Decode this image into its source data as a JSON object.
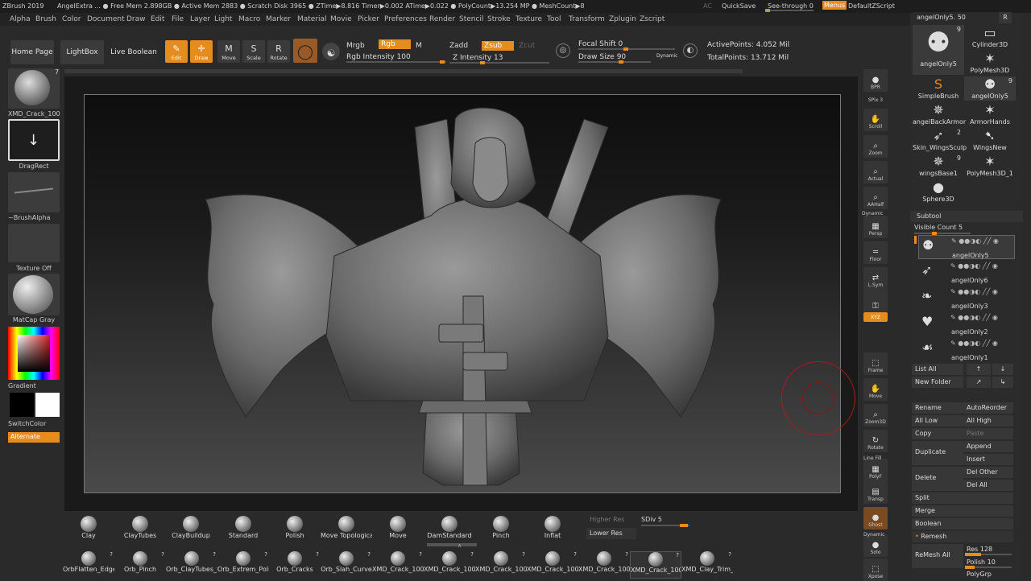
{
  "titlebar": {
    "app": "ZBrush 2019",
    "doc": "AngelExtra",
    "stats": "… ● Free Mem 2.898GB ● Active Mem 2883 ● Scratch Disk 3965 ● ZTime▶8.816 Timer▶0.002 ATime▶0.022 ● PolyCount▶13.254 MP ● MeshCount▶8",
    "ac": "AC",
    "quicksave": "QuickSave",
    "seethrough": "See-through  0",
    "seethrough_value": 0,
    "menus": "Menus",
    "script": "DefaultZScript"
  },
  "menus": [
    "Alpha",
    "Brush",
    "Color",
    "Document",
    "Draw",
    "Edit",
    "File",
    "Layer",
    "Light",
    "Macro",
    "Marker",
    "Material",
    "Movie",
    "Picker",
    "Preferences",
    "Render",
    "Stencil",
    "Stroke",
    "Texture",
    "Tool",
    "Transform",
    "Zplugin",
    "Zscript"
  ],
  "toolbar": {
    "home": "Home Page",
    "lightbox": "LightBox",
    "liveboolean": "Live Boolean",
    "tools": [
      {
        "name": "edit",
        "label": "Edit",
        "icon": "✎",
        "on": true
      },
      {
        "name": "draw",
        "label": "Draw",
        "icon": "✛",
        "on": true
      },
      {
        "name": "move",
        "label": "Move",
        "icon": "M",
        "on": false
      },
      {
        "name": "scale",
        "label": "Scale",
        "icon": "S",
        "on": false
      },
      {
        "name": "rotate",
        "label": "Rotate",
        "icon": "R",
        "on": false
      }
    ],
    "mrgb": "Mrgb",
    "rgb": "Rgb",
    "m": "M",
    "rgb_intensity": "Rgb Intensity 100",
    "zadd": "Zadd",
    "zsub": "Zsub",
    "zcut": "Zcut",
    "z_intensity": "Z Intensity 13",
    "focal_shift": "Focal Shift 0",
    "draw_size": "Draw Size 90",
    "dynamic": "Dynamic",
    "active_points": "ActivePoints: 4.052 Mil",
    "total_points": "TotalPoints: 13.712 Mil"
  },
  "left": {
    "alpha": "XMD_Crack_100",
    "alpha_count": "7",
    "stroke": "DragRect",
    "brushalpha": "~BrushAlpha",
    "texture": "Texture Off",
    "material": "MatCap Gray",
    "gradient": "Gradient",
    "switchcolor": "SwitchColor",
    "alternate": "Alternate"
  },
  "shelf": [
    {
      "name": "bpr",
      "label": "BPR",
      "icon": "●"
    },
    {
      "name": "spix",
      "label": "SPix 3",
      "icon": ""
    },
    {
      "name": "scroll",
      "label": "Scroll",
      "icon": "✋"
    },
    {
      "name": "zoom",
      "label": "Zoom",
      "icon": "⌕"
    },
    {
      "name": "actual",
      "label": "Actual",
      "icon": "⌕"
    },
    {
      "name": "aahalf",
      "label": "AAHalf",
      "icon": "⌕"
    },
    {
      "name": "persp",
      "label": "Persp",
      "icon": "▦"
    },
    {
      "name": "floor",
      "label": "Floor",
      "icon": "═"
    },
    {
      "name": "lsym",
      "label": "L.Sym",
      "icon": "⇄"
    },
    {
      "name": "lock",
      "label": "",
      "icon": "⚿"
    },
    {
      "name": "xyz",
      "label": "XYZ",
      "icon": ""
    },
    {
      "name": "frame",
      "label": "Frame",
      "icon": "⬚"
    },
    {
      "name": "move",
      "label": "Move",
      "icon": "✋"
    },
    {
      "name": "zoom3d",
      "label": "Zoom3D",
      "icon": "⌕"
    },
    {
      "name": "rotate",
      "label": "Rotate",
      "icon": "↻"
    },
    {
      "name": "polyf",
      "label": "PolyF",
      "icon": "▦"
    },
    {
      "name": "transp",
      "label": "Transp",
      "icon": "▤"
    },
    {
      "name": "ghost",
      "label": "Ghost",
      "icon": "●"
    },
    {
      "name": "solo",
      "label": "Solo",
      "icon": "●"
    },
    {
      "name": "xpose",
      "label": "Xpose",
      "icon": "⬚"
    }
  ],
  "shelf_extra": {
    "dynamic": "Dynamic",
    "linefill": "Line Fill",
    "dynamic2": "Dynamic"
  },
  "toolpalette": {
    "current": "angelOnly5. 50",
    "r": "R",
    "items": [
      {
        "label": "angelOnly5",
        "count": "9",
        "icon": "⚉"
      },
      {
        "label": "Cylinder3D",
        "count": "",
        "icon": "▭"
      },
      {
        "label": "PolyMesh3D",
        "count": "",
        "icon": "✶"
      },
      {
        "label": "SimpleBrush",
        "count": "",
        "icon": "S"
      },
      {
        "label": "angelOnly5",
        "count": "9",
        "icon": "⚉"
      },
      {
        "label": "angelBackArmor",
        "count": "",
        "icon": "✵"
      },
      {
        "label": "ArmorHands",
        "count": "",
        "icon": "✶"
      },
      {
        "label": "Skin_WingsSculp",
        "count": "2",
        "icon": "➶"
      },
      {
        "label": "WingsNew",
        "count": "",
        "icon": "➷"
      },
      {
        "label": "wingsBase1",
        "count": "9",
        "icon": "✵"
      },
      {
        "label": "PolyMesh3D_1",
        "count": "",
        "icon": "✶"
      },
      {
        "label": "Sphere3D",
        "count": "",
        "icon": "●"
      }
    ],
    "subtool": "Subtool",
    "visible_count": "Visible Count 5",
    "subtools": [
      "angelOnly5",
      "angelOnly6",
      "angelOnly3",
      "angelOnly2",
      "angelOnly1"
    ],
    "listall": "List All",
    "newfolder": "New Folder",
    "rename": "Rename",
    "autoreorder": "AutoReorder",
    "alllow": "All Low",
    "allhigh": "All High",
    "copy": "Copy",
    "paste": "Paste",
    "duplicate": "Duplicate",
    "append": "Append",
    "insert": "Insert",
    "delete": "Delete",
    "delother": "Del Other",
    "delall": "Del All",
    "split": "Split",
    "merge": "Merge",
    "boolean": "Boolean",
    "remesh": "Remesh",
    "remeshall": "ReMesh All",
    "res": "Res 128",
    "polish": "Polish 10",
    "polygrp": "PolyGrp"
  },
  "bottom": {
    "brushes1": [
      "Clay",
      "ClayTubes",
      "ClayBuildup",
      "Standard",
      "Polish",
      "Move Topologica",
      "Move",
      "DamStandard",
      "Pinch",
      "Inflat"
    ],
    "brushes2": [
      "OrbFlatten_Edge",
      "Orb_Pinch",
      "Orb_ClayTubes_Sl",
      "Orb_Extrem_Poli",
      "Orb_Cracks",
      "Orb_Slah_Curve",
      "XMD_Crack_1008",
      "XMD_Crack_1007",
      "XMD_Crack_1006",
      "XMD_Crack_1003",
      "XMD_Crack_1002",
      "XMD_Crack_100",
      "XMD_Clay_Trim_"
    ],
    "higherres": "Higher Res",
    "lowerres": "Lower Res",
    "sdiv": "SDiv 5",
    "question": "?"
  },
  "colors": {
    "accent": "#e58c1f",
    "panel": "#2b2b2b",
    "cursor": "#b01818"
  }
}
